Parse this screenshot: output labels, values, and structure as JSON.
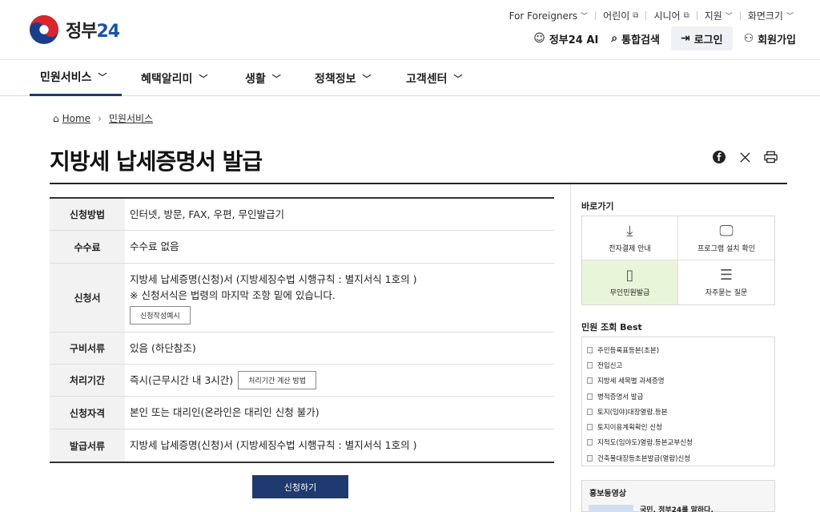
{
  "logo": {
    "brand": "정부",
    "num": "24"
  },
  "utility": [
    {
      "label": "For Foreigners",
      "mark": "chevron"
    },
    {
      "label": "어린이",
      "mark": "external"
    },
    {
      "label": "시니어",
      "mark": "external"
    },
    {
      "label": "지원",
      "mark": "chevron"
    },
    {
      "label": "화면크기",
      "mark": "chevron"
    }
  ],
  "actions": {
    "ai": "정부24 AI",
    "search": "통합검색",
    "login": "로그인",
    "signup": "회원가입"
  },
  "gnb": [
    {
      "label": "민원서비스",
      "active": true
    },
    {
      "label": "혜택알리미",
      "active": false
    },
    {
      "label": "생활",
      "active": false
    },
    {
      "label": "정책정보",
      "active": false
    },
    {
      "label": "고객센터",
      "active": false
    }
  ],
  "breadcrumb": {
    "home": "Home",
    "current": "민원서비스"
  },
  "page": {
    "title": "지방세 납세증명서 발급"
  },
  "info": {
    "method_label": "신청방법",
    "method": "인터넷, 방문, FAX, 우편, 무인발급기",
    "fee_label": "수수료",
    "fee": "수수료 없음",
    "form_label": "신청서",
    "form_line1": "지방세 납세증명(신청)서 (지방세징수법 시행규칙 : 별지서식 1호의 )",
    "form_line2": "※ 신청서식은 법령의 마지막 조항 밑에 있습니다.",
    "form_button": "신청작성예시",
    "docs_label": "구비서류",
    "docs": "있음 (하단참조)",
    "period_label": "처리기간",
    "period": "즉시(근무시간 내 3시간)",
    "period_button": "처리기간 계산 방법",
    "qualify_label": "신청자격",
    "qualify": "본인 또는 대리인(온라인은 대리인 신청 불가)",
    "issue_label": "발급서류",
    "issue": "지방세 납세증명(신청)서 (지방세징수법 시행규칙 : 별지서식 1호의 )"
  },
  "apply_button": "신청하기",
  "side": {
    "quick_title": "바로가기",
    "quick": [
      {
        "label": "전자결제 안내",
        "icon": "download-icon"
      },
      {
        "label": "프로그램 설치 확인",
        "icon": "monitor-icon"
      },
      {
        "label": "무인민원발급",
        "icon": "kiosk-icon"
      },
      {
        "label": "자주묻는 질문",
        "icon": "chat-icon"
      }
    ],
    "best_title": "민원 조회 Best",
    "best": [
      "주민등록표등본(초본)",
      "전입신고",
      "지방세 세목별 과세증명",
      "병적증명서 발급",
      "토지(임야)대장열람.등본",
      "토지이용계획확인 신청",
      "지적도(임야도)열람.등본교부신청",
      "건축물대장등초본발급(열람)신청"
    ],
    "promo_title": "홍보동영상",
    "promo_text": "국민, 정부24를 말하다."
  },
  "colors": {
    "navy": "#1e3a6e",
    "quick_highlight": "#e9f5d9"
  }
}
